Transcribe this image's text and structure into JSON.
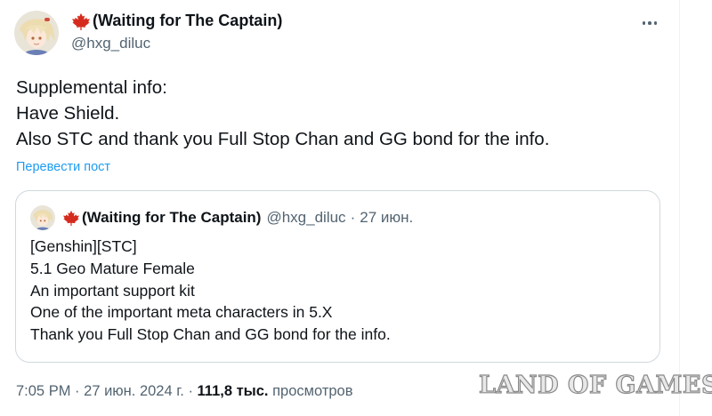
{
  "author": {
    "display_name": "(Waiting for The Captain)",
    "handle": "@hxg_diluc",
    "flag_icon": "maple-leaf-icon"
  },
  "post": {
    "lines": [
      "Supplemental info:",
      "Have Shield.",
      "Also STC and thank you Full Stop Chan and GG bond for the info."
    ],
    "translate_label": "Перевести пост"
  },
  "quoted": {
    "display_name": "(Waiting for The Captain)",
    "handle": "@hxg_diluc",
    "separator": "·",
    "date": "27 июн.",
    "lines": [
      "[Genshin][STC]",
      "5.1 Geo Mature Female",
      "An important support kit",
      "One of the important meta characters in 5.X",
      "Thank you Full Stop Chan and GG bond for the info."
    ]
  },
  "meta": {
    "time": "7:05 PM",
    "separator": "·",
    "date": "27 июн. 2024 г.",
    "views_count": "111,8 тыс.",
    "views_label": "просмотров"
  },
  "watermark": "LAND OF GAMES",
  "colors": {
    "accent": "#1d9bf0",
    "secondary_text": "#536471",
    "primary_text": "#0f1419",
    "flag_red": "#d52b1e",
    "border": "#cfd9de"
  }
}
